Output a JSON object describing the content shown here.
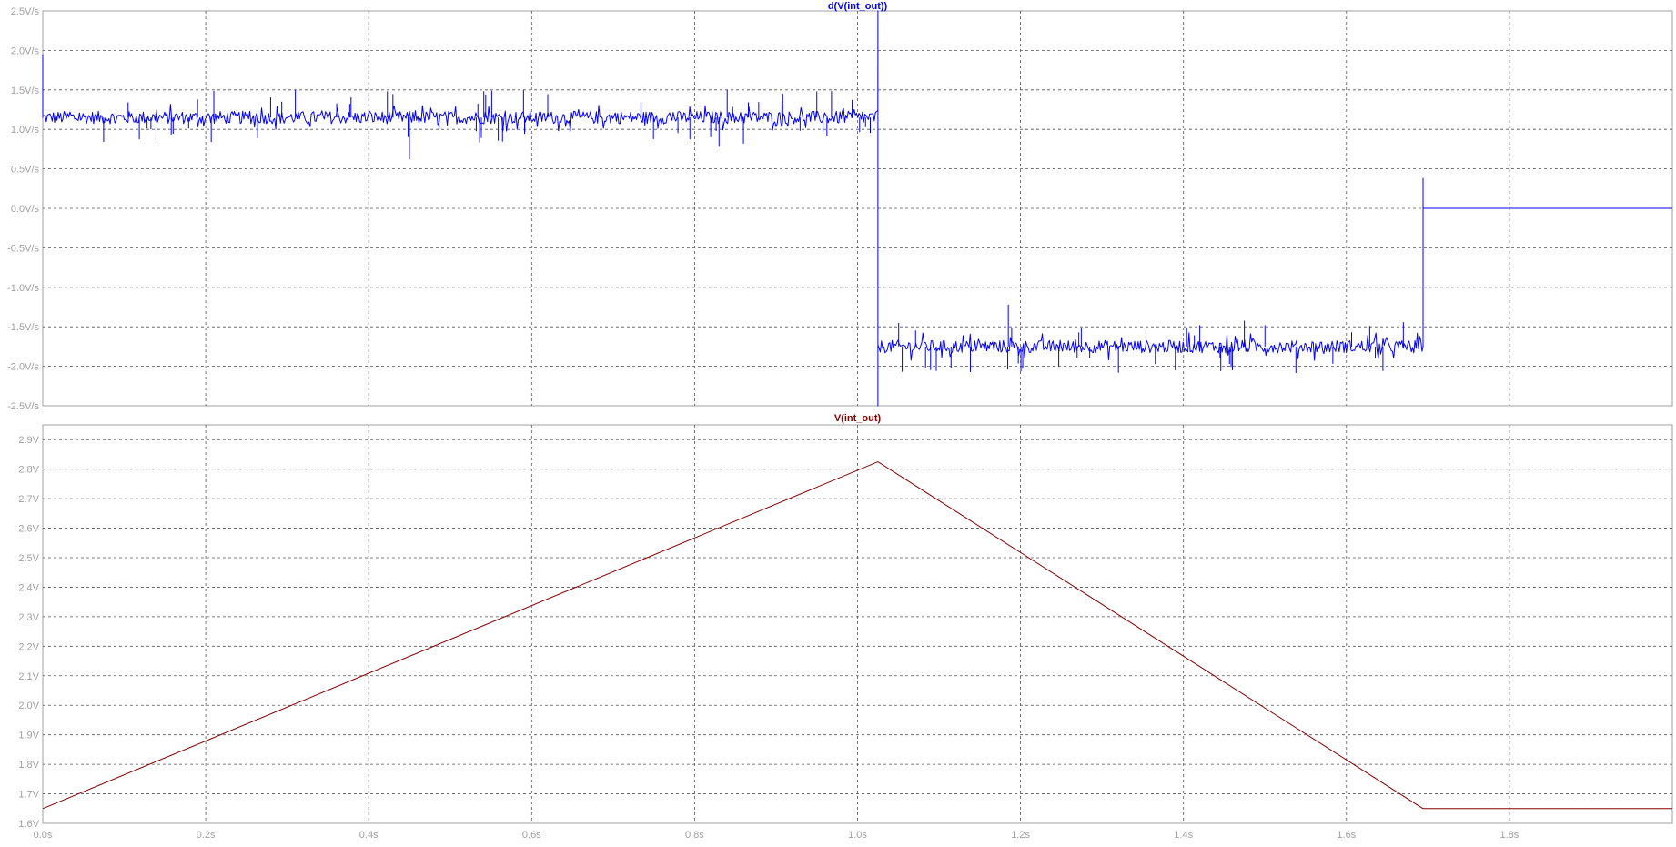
{
  "chart_data": [
    {
      "type": "line",
      "title": "d(V(int_out))",
      "unit": "V/s",
      "color": "#0000ff",
      "xlim": [
        0,
        2.0
      ],
      "ylim": [
        -2.5,
        2.5
      ],
      "x_ticks": [
        0.0,
        0.2,
        0.4,
        0.6,
        0.8,
        1.0,
        1.2,
        1.4,
        1.6,
        1.8
      ],
      "y_ticks": [
        2.5,
        2.0,
        1.5,
        1.0,
        0.5,
        0.0,
        -0.5,
        -1.0,
        -1.5,
        -2.0,
        -2.5
      ],
      "x_tick_labels": [
        "0.0s",
        "0.2s",
        "0.4s",
        "0.6s",
        "0.8s",
        "1.0s",
        "1.2s",
        "1.4s",
        "1.6s",
        "1.8s"
      ],
      "y_tick_labels": [
        "2.5V/s",
        "2.0V/s",
        "1.5V/s",
        "1.0V/s",
        "0.5V/s",
        "0.0V/s",
        "-0.5V/s",
        "-1.0V/s",
        "-1.5V/s",
        "-2.0V/s",
        "-2.5V/s"
      ],
      "grid": true,
      "series": [
        {
          "x": [
            0,
            0.0,
            1.025,
            1.025,
            1.025,
            1.694,
            1.694,
            1.694,
            2.0
          ],
          "y": [
            1.95,
            1.15,
            1.15,
            2.5,
            -1.75,
            -1.75,
            0.38,
            0.0,
            0.0
          ],
          "noise": [
            {
              "x_start": 0.0,
              "x_end": 1.025,
              "center": 1.15,
              "amplitude": 0.08
            },
            {
              "x_start": 1.025,
              "x_end": 1.694,
              "center": -1.75,
              "amplitude": 0.08
            }
          ],
          "spikes": [
            {
              "x": 0.45,
              "y": 0.62
            },
            {
              "x": 0.31,
              "y": 1.5
            },
            {
              "x": 0.59,
              "y": 1.5
            },
            {
              "x": 0.84,
              "y": 1.5
            },
            {
              "x": 0.95,
              "y": 1.48
            },
            {
              "x": 0.19,
              "y": 1.38
            },
            {
              "x": 0.83,
              "y": 0.78
            },
            {
              "x": 1.185,
              "y": -1.22
            },
            {
              "x": 1.39,
              "y": -2.05
            },
            {
              "x": 1.42,
              "y": -1.48
            },
            {
              "x": 1.5,
              "y": -1.48
            },
            {
              "x": 1.46,
              "y": -2.05
            }
          ]
        }
      ]
    },
    {
      "type": "line",
      "title": "V(int_out)",
      "unit": "V",
      "color": "#8b0000",
      "xlim": [
        0,
        2.0
      ],
      "ylim": [
        1.6,
        2.95
      ],
      "x_ticks": [
        0.0,
        0.2,
        0.4,
        0.6,
        0.8,
        1.0,
        1.2,
        1.4,
        1.6,
        1.8
      ],
      "y_ticks": [
        2.9,
        2.8,
        2.7,
        2.6,
        2.5,
        2.4,
        2.3,
        2.2,
        2.1,
        2.0,
        1.9,
        1.8,
        1.7,
        1.6
      ],
      "x_tick_labels": [
        "0.0s",
        "0.2s",
        "0.4s",
        "0.6s",
        "0.8s",
        "1.0s",
        "1.2s",
        "1.4s",
        "1.6s",
        "1.8s"
      ],
      "y_tick_labels": [
        "2.9V",
        "2.8V",
        "2.7V",
        "2.6V",
        "2.5V",
        "2.4V",
        "2.3V",
        "2.2V",
        "2.1V",
        "2.0V",
        "1.9V",
        "1.8V",
        "1.7V",
        "1.6V"
      ],
      "grid": true,
      "series": [
        {
          "x": [
            0.0,
            1.025,
            1.694,
            2.0
          ],
          "y": [
            1.65,
            2.825,
            1.65,
            1.65
          ]
        }
      ]
    }
  ]
}
